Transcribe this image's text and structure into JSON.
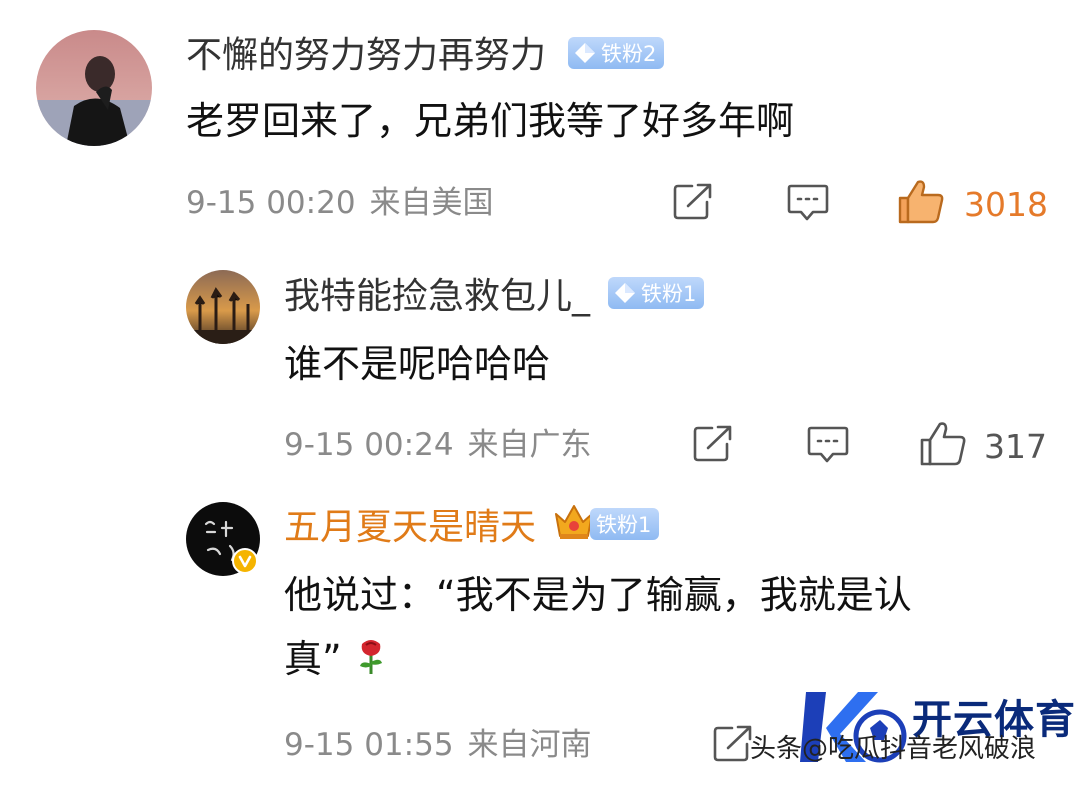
{
  "comments": [
    {
      "username": "不懈的努力努力再努力",
      "badge": "铁粉2",
      "text": "老罗回来了，兄弟们我等了好多年啊",
      "time": "9-15 00:20",
      "location": "来自美国",
      "likes": "3018"
    },
    {
      "username": "我特能捡急救包儿_",
      "badge": "铁粉1",
      "text": "谁不是呢哈哈哈",
      "time": "9-15 00:24",
      "location": "来自广东",
      "likes": "317"
    },
    {
      "username": "五月夏天是晴天",
      "badge": "铁粉1",
      "text_line1": "他说过：“我不是为了输赢，我就是认",
      "text_line2": "真”",
      "time": "9-15 01:55",
      "location": "来自河南",
      "likes": ""
    }
  ],
  "watermark": {
    "title": "开云体育",
    "source": "头条@吃瓜抖音老风破浪"
  },
  "icons": {
    "share": "share-icon",
    "comment": "comment-icon",
    "like": "thumbs-up-icon",
    "liked": "thumbs-up-filled-icon",
    "rose": "rose-emoji",
    "crown": "crown-icon",
    "verified": "verified-v-icon",
    "diamond": "diamond-icon"
  },
  "colors": {
    "badge": "#8fbaf2",
    "liked": "#e57a2a",
    "vip_name": "#e07b18",
    "meta": "#8a8a8a"
  }
}
